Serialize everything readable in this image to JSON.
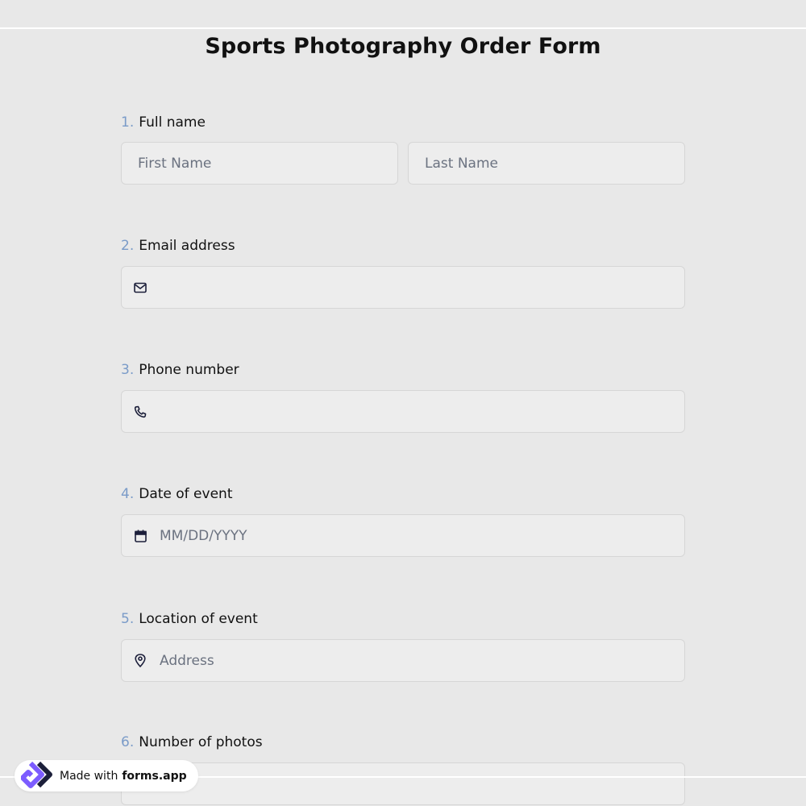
{
  "form": {
    "title": "Sports Photography Order Form"
  },
  "questions": [
    {
      "number": "1.",
      "label": "Full name",
      "fields": [
        {
          "placeholder": "First Name"
        },
        {
          "placeholder": "Last Name"
        }
      ]
    },
    {
      "number": "2.",
      "label": "Email address",
      "icon": "envelope-icon",
      "placeholder": ""
    },
    {
      "number": "3.",
      "label": "Phone number",
      "icon": "phone-icon",
      "placeholder": ""
    },
    {
      "number": "4.",
      "label": "Date of event",
      "icon": "calendar-icon",
      "placeholder": "MM/DD/YYYY"
    },
    {
      "number": "5.",
      "label": "Location of event",
      "icon": "map-pin-icon",
      "placeholder": "Address"
    },
    {
      "number": "6.",
      "label": "Number of photos",
      "placeholder": ""
    }
  ],
  "badge": {
    "prefix": "Made with",
    "brand": "forms.app",
    "logo_icon": "forms-app-logo-icon"
  },
  "colors": {
    "background": "#e8e8e8",
    "field_background": "#ededed",
    "question_number": "#7a9bc8",
    "logo_purple": "#7c5cff",
    "logo_dark": "#1c1f3a"
  }
}
